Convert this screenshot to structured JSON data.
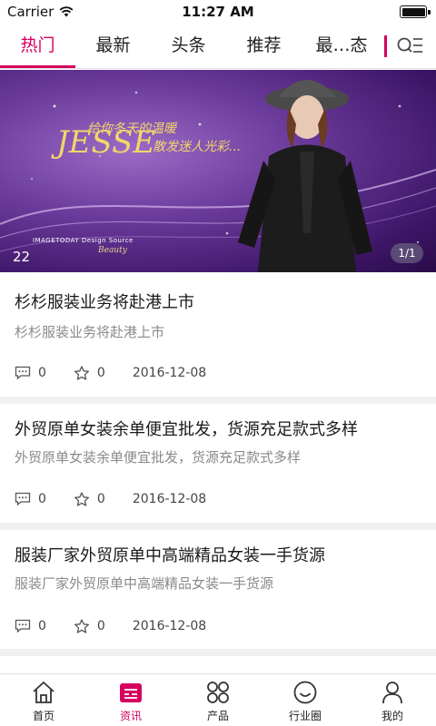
{
  "status_bar": {
    "carrier": "Carrier",
    "time": "11:27 AM"
  },
  "tabs": [
    {
      "label": "热门",
      "active": true
    },
    {
      "label": "最新",
      "active": false
    },
    {
      "label": "头条",
      "active": false
    },
    {
      "label": "推荐",
      "active": false
    },
    {
      "label": "最…态",
      "active": false
    }
  ],
  "banner": {
    "headline_line1": "给你冬天的温暖",
    "headline_line2": "散发迷人光彩...",
    "script_text": "JESSE",
    "brand_text": "IMAGETODAY Design Source",
    "brand_sub": "Beauty",
    "counter": "22",
    "pager": "1/1"
  },
  "news": [
    {
      "title": "杉杉服装业务将赴港上市",
      "summary": "杉杉服装业务将赴港上市",
      "comments": "0",
      "likes": "0",
      "date": "2016-12-08"
    },
    {
      "title": "外贸原单女装余单便宜批发，货源充足款式多样",
      "summary": "外贸原单女装余单便宜批发，货源充足款式多样",
      "comments": "0",
      "likes": "0",
      "date": "2016-12-08"
    },
    {
      "title": "服装厂家外贸原单中高端精品女装一手货源",
      "summary": "服装厂家外贸原单中高端精品女装一手货源",
      "comments": "0",
      "likes": "0",
      "date": "2016-12-08"
    }
  ],
  "bottom_nav": [
    {
      "label": "首页",
      "icon": "home-icon",
      "active": false
    },
    {
      "label": "资讯",
      "icon": "news-icon",
      "active": true
    },
    {
      "label": "产品",
      "icon": "grid-icon",
      "active": false
    },
    {
      "label": "行业圈",
      "icon": "smile-icon",
      "active": false
    },
    {
      "label": "我的",
      "icon": "user-icon",
      "active": false
    }
  ],
  "colors": {
    "accent": "#d6005f",
    "text": "#1a1a1a",
    "muted": "#8a8a8a",
    "separator": "#f0f0f0"
  }
}
